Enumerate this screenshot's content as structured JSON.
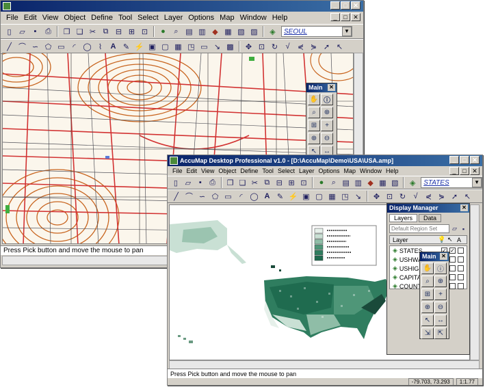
{
  "back_window": {
    "title": "",
    "menus": [
      "File",
      "Edit",
      "View",
      "Object",
      "Define",
      "Tool",
      "Select",
      "Layer",
      "Options",
      "Map",
      "Window",
      "Help"
    ],
    "layer_combo": "SEOUL",
    "status": "Press Pick button and move the mouse to pan",
    "main_palette": {
      "title": "Main"
    }
  },
  "front_window": {
    "title": "AccuMap Desktop Professional v1.0 - [D:\\AccuMap\\Demo\\USA\\USA.amp]",
    "menus": [
      "File",
      "Edit",
      "View",
      "Object",
      "Define",
      "Tool",
      "Select",
      "Layer",
      "Options",
      "Map",
      "Window",
      "Help"
    ],
    "layer_combo": "STATES",
    "status": "Press Pick button and move the mouse to pan",
    "status_coords": "-79.703, 73.293",
    "status_zoom": "1:1.77",
    "display_manager": {
      "title": "Display Manager",
      "tabs": [
        "Layers",
        "Data"
      ],
      "region_placeholder": "Default Region Set",
      "column_header": "Layer",
      "layers": [
        {
          "name": "STATES",
          "visible": true,
          "selectable": true
        },
        {
          "name": "USHWAYS",
          "visible": true,
          "selectable": false
        },
        {
          "name": "USHIGH",
          "visible": true,
          "selectable": false
        },
        {
          "name": "CAPITALS",
          "visible": true,
          "selectable": false
        },
        {
          "name": "COUNTIES",
          "visible": true,
          "selectable": false
        }
      ]
    },
    "main_palette": {
      "title": "Main"
    }
  },
  "colors": {
    "titlebar": "#0a246a",
    "contour": "#c8641e",
    "road": "#d23232",
    "choropleth_dark": "#1f6b4f",
    "choropleth_light": "#c9e0d4"
  }
}
